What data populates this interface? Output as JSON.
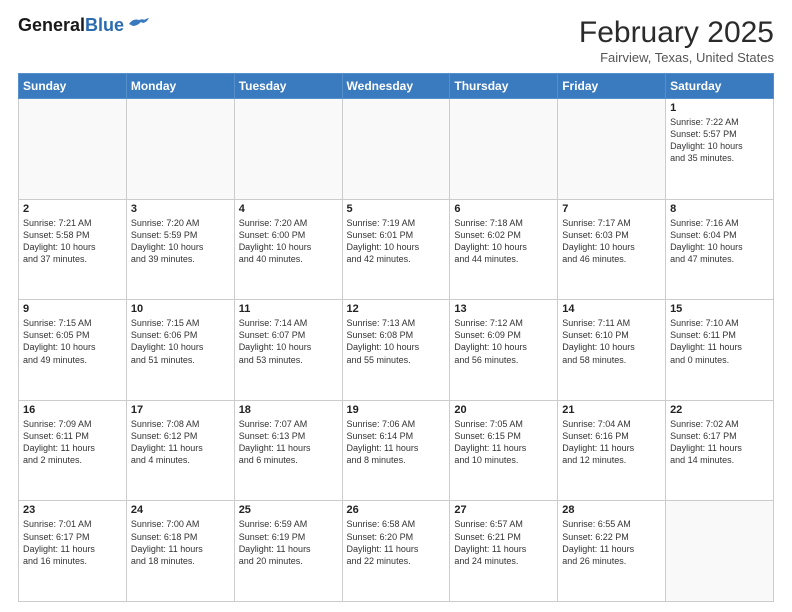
{
  "header": {
    "logo_general": "General",
    "logo_blue": "Blue",
    "month_title": "February 2025",
    "location": "Fairview, Texas, United States"
  },
  "days_of_week": [
    "Sunday",
    "Monday",
    "Tuesday",
    "Wednesday",
    "Thursday",
    "Friday",
    "Saturday"
  ],
  "weeks": [
    [
      {
        "day": "",
        "info": ""
      },
      {
        "day": "",
        "info": ""
      },
      {
        "day": "",
        "info": ""
      },
      {
        "day": "",
        "info": ""
      },
      {
        "day": "",
        "info": ""
      },
      {
        "day": "",
        "info": ""
      },
      {
        "day": "1",
        "info": "Sunrise: 7:22 AM\nSunset: 5:57 PM\nDaylight: 10 hours\nand 35 minutes."
      }
    ],
    [
      {
        "day": "2",
        "info": "Sunrise: 7:21 AM\nSunset: 5:58 PM\nDaylight: 10 hours\nand 37 minutes."
      },
      {
        "day": "3",
        "info": "Sunrise: 7:20 AM\nSunset: 5:59 PM\nDaylight: 10 hours\nand 39 minutes."
      },
      {
        "day": "4",
        "info": "Sunrise: 7:20 AM\nSunset: 6:00 PM\nDaylight: 10 hours\nand 40 minutes."
      },
      {
        "day": "5",
        "info": "Sunrise: 7:19 AM\nSunset: 6:01 PM\nDaylight: 10 hours\nand 42 minutes."
      },
      {
        "day": "6",
        "info": "Sunrise: 7:18 AM\nSunset: 6:02 PM\nDaylight: 10 hours\nand 44 minutes."
      },
      {
        "day": "7",
        "info": "Sunrise: 7:17 AM\nSunset: 6:03 PM\nDaylight: 10 hours\nand 46 minutes."
      },
      {
        "day": "8",
        "info": "Sunrise: 7:16 AM\nSunset: 6:04 PM\nDaylight: 10 hours\nand 47 minutes."
      }
    ],
    [
      {
        "day": "9",
        "info": "Sunrise: 7:15 AM\nSunset: 6:05 PM\nDaylight: 10 hours\nand 49 minutes."
      },
      {
        "day": "10",
        "info": "Sunrise: 7:15 AM\nSunset: 6:06 PM\nDaylight: 10 hours\nand 51 minutes."
      },
      {
        "day": "11",
        "info": "Sunrise: 7:14 AM\nSunset: 6:07 PM\nDaylight: 10 hours\nand 53 minutes."
      },
      {
        "day": "12",
        "info": "Sunrise: 7:13 AM\nSunset: 6:08 PM\nDaylight: 10 hours\nand 55 minutes."
      },
      {
        "day": "13",
        "info": "Sunrise: 7:12 AM\nSunset: 6:09 PM\nDaylight: 10 hours\nand 56 minutes."
      },
      {
        "day": "14",
        "info": "Sunrise: 7:11 AM\nSunset: 6:10 PM\nDaylight: 10 hours\nand 58 minutes."
      },
      {
        "day": "15",
        "info": "Sunrise: 7:10 AM\nSunset: 6:11 PM\nDaylight: 11 hours\nand 0 minutes."
      }
    ],
    [
      {
        "day": "16",
        "info": "Sunrise: 7:09 AM\nSunset: 6:11 PM\nDaylight: 11 hours\nand 2 minutes."
      },
      {
        "day": "17",
        "info": "Sunrise: 7:08 AM\nSunset: 6:12 PM\nDaylight: 11 hours\nand 4 minutes."
      },
      {
        "day": "18",
        "info": "Sunrise: 7:07 AM\nSunset: 6:13 PM\nDaylight: 11 hours\nand 6 minutes."
      },
      {
        "day": "19",
        "info": "Sunrise: 7:06 AM\nSunset: 6:14 PM\nDaylight: 11 hours\nand 8 minutes."
      },
      {
        "day": "20",
        "info": "Sunrise: 7:05 AM\nSunset: 6:15 PM\nDaylight: 11 hours\nand 10 minutes."
      },
      {
        "day": "21",
        "info": "Sunrise: 7:04 AM\nSunset: 6:16 PM\nDaylight: 11 hours\nand 12 minutes."
      },
      {
        "day": "22",
        "info": "Sunrise: 7:02 AM\nSunset: 6:17 PM\nDaylight: 11 hours\nand 14 minutes."
      }
    ],
    [
      {
        "day": "23",
        "info": "Sunrise: 7:01 AM\nSunset: 6:17 PM\nDaylight: 11 hours\nand 16 minutes."
      },
      {
        "day": "24",
        "info": "Sunrise: 7:00 AM\nSunset: 6:18 PM\nDaylight: 11 hours\nand 18 minutes."
      },
      {
        "day": "25",
        "info": "Sunrise: 6:59 AM\nSunset: 6:19 PM\nDaylight: 11 hours\nand 20 minutes."
      },
      {
        "day": "26",
        "info": "Sunrise: 6:58 AM\nSunset: 6:20 PM\nDaylight: 11 hours\nand 22 minutes."
      },
      {
        "day": "27",
        "info": "Sunrise: 6:57 AM\nSunset: 6:21 PM\nDaylight: 11 hours\nand 24 minutes."
      },
      {
        "day": "28",
        "info": "Sunrise: 6:55 AM\nSunset: 6:22 PM\nDaylight: 11 hours\nand 26 minutes."
      },
      {
        "day": "",
        "info": ""
      }
    ]
  ]
}
